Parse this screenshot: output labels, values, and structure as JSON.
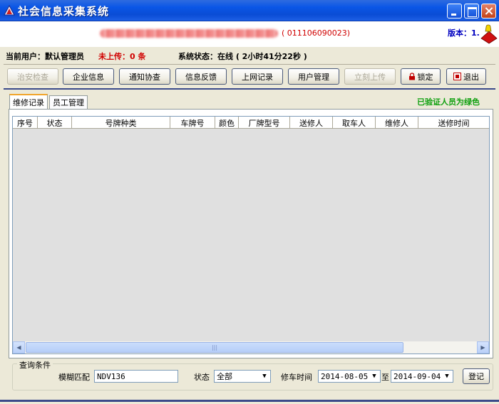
{
  "window": {
    "title": "社会信息采集系统"
  },
  "header": {
    "code": "( 011106090023)",
    "version": "版本：1."
  },
  "status": {
    "current_user": "当前用户：默认管理员",
    "not_uploaded": "未上传：0 条",
    "system_status": "系统状态：在线 ( 2小时41分22秒 )"
  },
  "toolbar": {
    "security_check": "治安检查",
    "company_info": "企业信息",
    "notice": "通知协查",
    "feedback": "信息反馈",
    "online_record": "上网记录",
    "user_mgmt": "用户管理",
    "upload_now": "立刻上传",
    "lock": "锁定",
    "exit": "退出"
  },
  "tabs": {
    "repair_records": "维修记录",
    "staff_mgmt": "员工管理"
  },
  "verified_note": "已验证人员为绿色",
  "table": {
    "columns": [
      "序号",
      "状态",
      "号牌种类",
      "车牌号",
      "颜色",
      "厂牌型号",
      "送修人",
      "取车人",
      "维修人",
      "送修时间"
    ]
  },
  "query": {
    "legend": "查询条件",
    "fuzzy_label": "模糊匹配",
    "fuzzy_value": "NDV136",
    "status_label": "状态",
    "status_value": "全部",
    "repair_time_label": "修车时间",
    "date_from": "2014-08-05",
    "to_label": "至",
    "date_to": "2014-09-04",
    "register": "登记"
  },
  "colors": {
    "titlebar": "#0A56E6",
    "accent_red": "#D00000",
    "verified_green": "#10A010",
    "version_blue": "#0000C0"
  },
  "icons": [
    "app-icon",
    "minimize-icon",
    "maximize-icon",
    "close-icon",
    "bell-icon",
    "lock-icon",
    "exit-icon",
    "chevron-down-icon",
    "chevron-left-icon",
    "chevron-right-icon"
  ]
}
